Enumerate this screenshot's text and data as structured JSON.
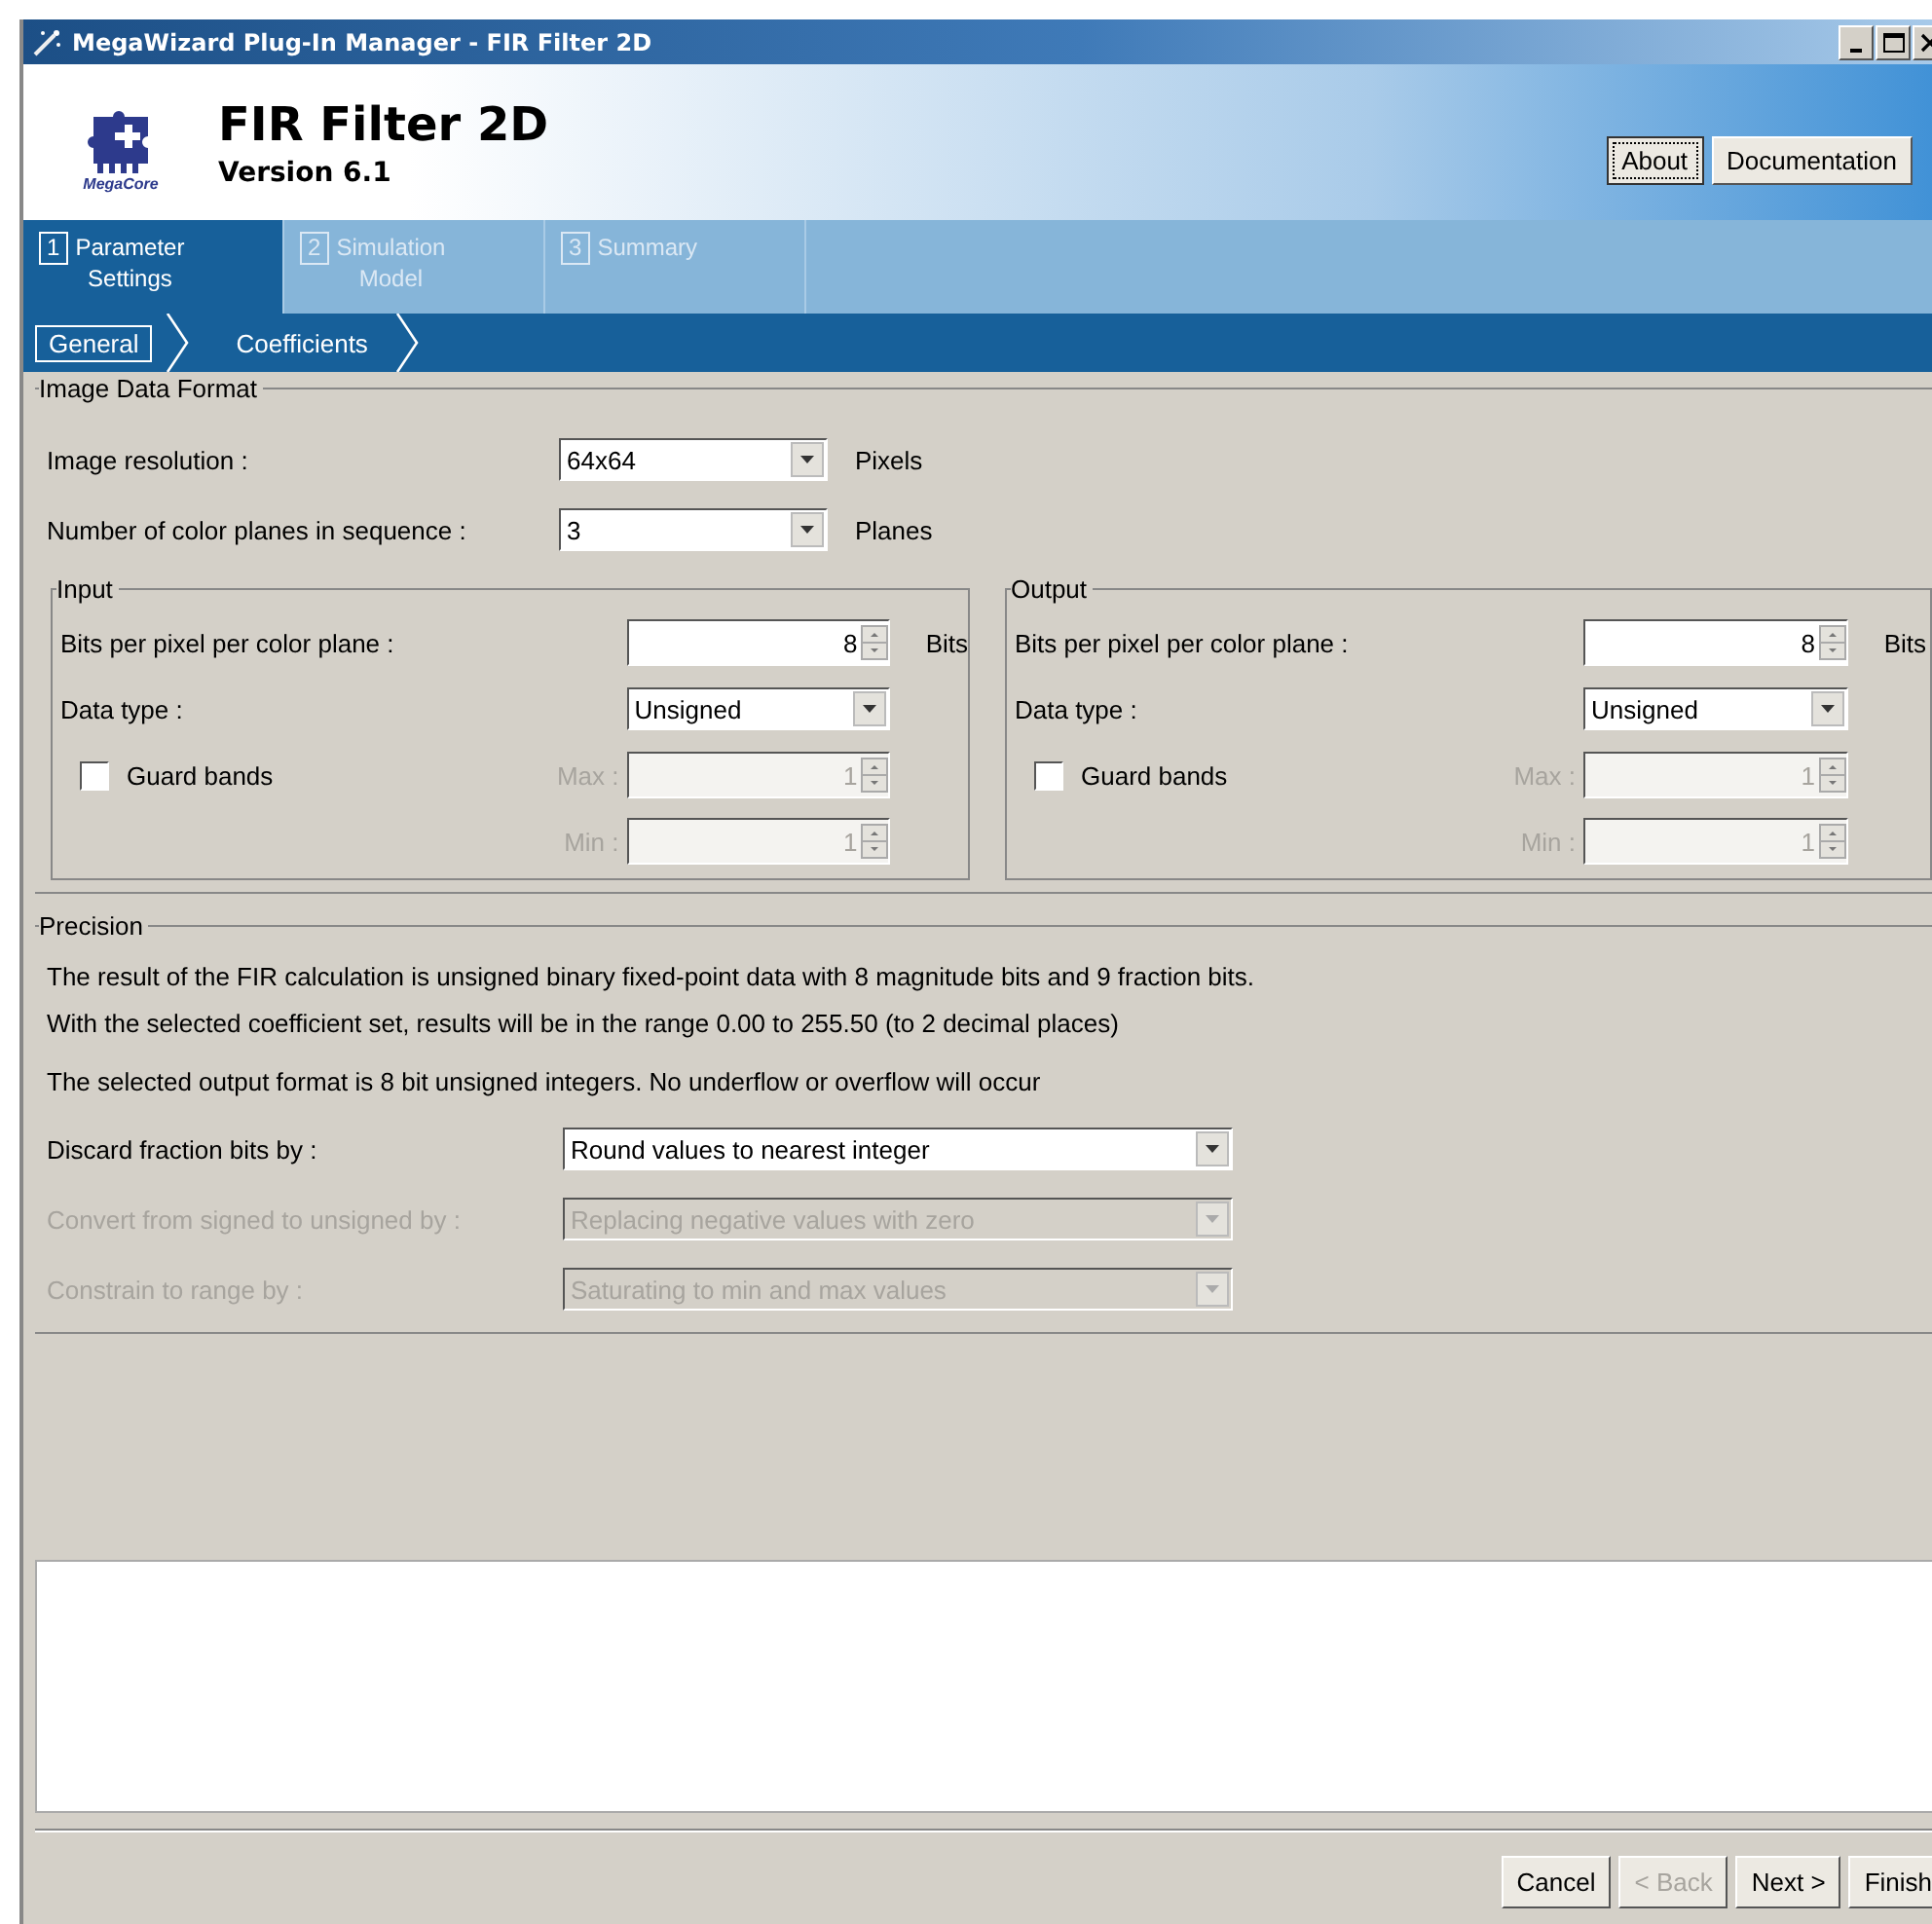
{
  "window": {
    "title": "MegaWizard Plug-In Manager - FIR Filter 2D"
  },
  "header": {
    "title": "FIR Filter 2D",
    "version": "Version 6.1",
    "logo_caption": "MegaCore",
    "buttons": [
      {
        "label": "About",
        "focused": true
      },
      {
        "label": "Documentation",
        "focused": false
      }
    ]
  },
  "steps": [
    {
      "number": "1",
      "label": "Parameter\nSettings",
      "selected": true
    },
    {
      "number": "2",
      "label": "Simulation\nModel",
      "selected": false
    },
    {
      "number": "3",
      "label": "Summary",
      "selected": false
    }
  ],
  "subtabs": [
    {
      "label": "General",
      "selected": true
    },
    {
      "label": "Coefficients",
      "selected": false
    }
  ],
  "image_data_format": {
    "title": "Image Data Format",
    "rows": [
      {
        "label": "Image resolution :",
        "value": "64x64",
        "unit": "Pixels"
      },
      {
        "label": "Number of color planes in sequence :",
        "value": "3",
        "unit": "Planes"
      }
    ]
  },
  "panels": [
    {
      "title": "Input",
      "bits": {
        "label": "Bits per pixel per color plane :",
        "value": "8",
        "unit": "Bits"
      },
      "data_type": {
        "label": "Data type :",
        "value": "Unsigned"
      },
      "guard_bands": {
        "label": "Guard bands",
        "checked": false
      },
      "max": {
        "label": "Max :",
        "value": "1",
        "disabled": true
      },
      "min": {
        "label": "Min :",
        "value": "1",
        "disabled": true
      }
    },
    {
      "title": "Output",
      "bits": {
        "label": "Bits per pixel per color plane :",
        "value": "8",
        "unit": "Bits"
      },
      "data_type": {
        "label": "Data type :",
        "value": "Unsigned"
      },
      "guard_bands": {
        "label": "Guard bands",
        "checked": false
      },
      "max": {
        "label": "Max :",
        "value": "1",
        "disabled": true
      },
      "min": {
        "label": "Min :",
        "value": "1",
        "disabled": true
      }
    }
  ],
  "precision": {
    "title": "Precision",
    "lines": [
      "The result of the FIR calculation is unsigned binary fixed-point data with 8 magnitude bits and 9 fraction bits.",
      "With the selected coefficient set, results will be in the range 0.00 to 255.50 (to 2 decimal places)",
      "The selected output format is 8 bit unsigned integers. No underflow or overflow will occur"
    ],
    "settings": [
      {
        "label": "Discard fraction bits by :",
        "value": "Round values to nearest integer",
        "disabled": false
      },
      {
        "label": "Convert from signed to unsigned by :",
        "value": "Replacing negative values with zero",
        "disabled": true
      },
      {
        "label": "Constrain to range by :",
        "value": "Saturating to min and max values",
        "disabled": true
      }
    ]
  },
  "buttons": [
    {
      "label": "Cancel",
      "disabled": false
    },
    {
      "label": "< Back",
      "disabled": true
    },
    {
      "label": "Next >",
      "disabled": false
    },
    {
      "label": "Finish",
      "disabled": false
    }
  ]
}
